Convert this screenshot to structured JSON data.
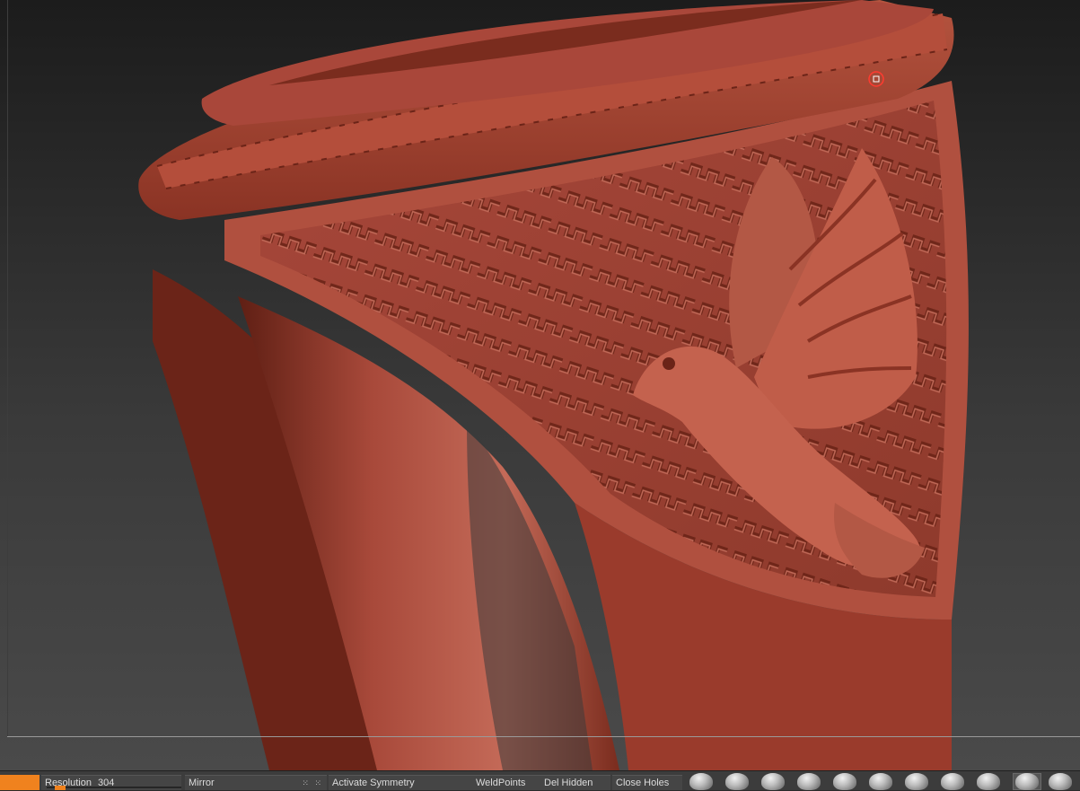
{
  "viewport": {
    "background": "#2f2f2f",
    "model": "ring-with-dove-relief",
    "model_color": "#a0402e"
  },
  "bottom_bar": {
    "resolution": {
      "label": "Resolution",
      "value": "304",
      "fraction": 0.06
    },
    "mirror": {
      "label": "Mirror"
    },
    "activate_symmetry": {
      "label": "Activate Symmetry"
    },
    "weld_points": {
      "label": "WeldPoints"
    },
    "del_hidden": {
      "label": "Del Hidden"
    },
    "close_holes": {
      "label": "Close Holes"
    },
    "brushes": [
      "brush-standard-icon",
      "brush-smooth-icon",
      "brush-inflate-icon",
      "brush-clay-icon",
      "brush-move-icon",
      "brush-dam-standard-icon",
      "brush-pinch-icon",
      "brush-snake-hook-icon",
      "brush-flatten-icon",
      "brush-curve-icon",
      "brush-material-icon"
    ],
    "accent": "#f0821e"
  }
}
